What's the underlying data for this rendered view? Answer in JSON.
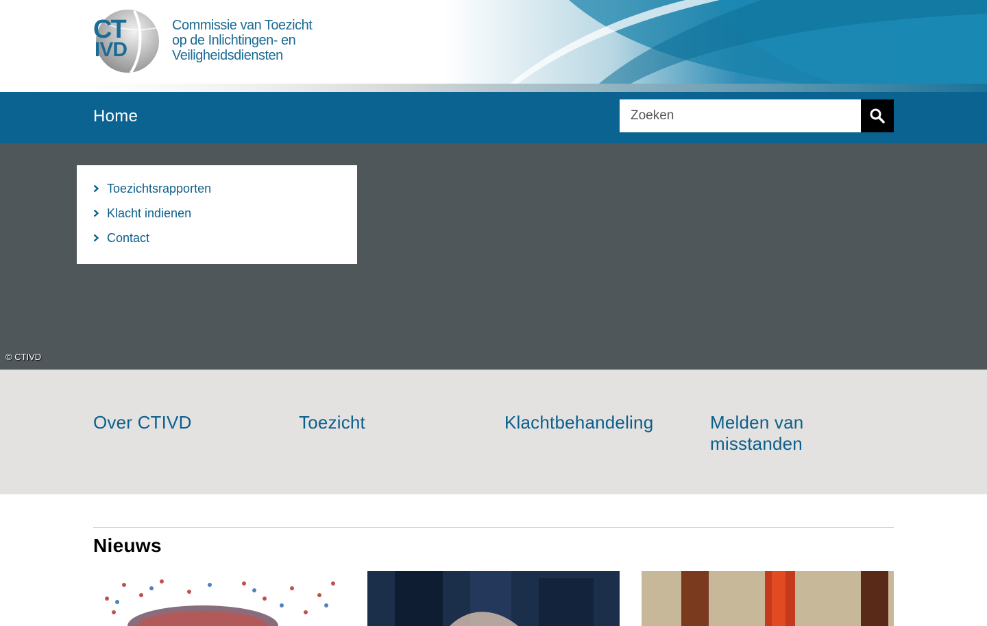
{
  "header": {
    "logo_ct": "CT",
    "logo_ivd": "IVD",
    "org_name_lines": [
      "Commissie van Toezicht",
      "op de Inlichtingen- en",
      "Veiligheidsdiensten"
    ],
    "colors": {
      "brand_blue": "#1b6a93",
      "banner_blue": "#1487b3"
    }
  },
  "nav": {
    "home_label": "Home",
    "search_placeholder": "Zoeken",
    "search_icon": "magnifier-icon",
    "bar_color": "#0a6391"
  },
  "hero": {
    "quick_links": [
      {
        "label": "Toezichtsrapporten"
      },
      {
        "label": "Klacht indienen"
      },
      {
        "label": "Contact"
      }
    ],
    "copyright": "© CTIVD",
    "background_color": "#4f575b"
  },
  "themes": [
    {
      "label": "Over CTIVD"
    },
    {
      "label": "Toezicht"
    },
    {
      "label": "Klachtbehandeling"
    },
    {
      "label": "Melden van misstanden"
    }
  ],
  "news": {
    "title": "Nieuws"
  }
}
